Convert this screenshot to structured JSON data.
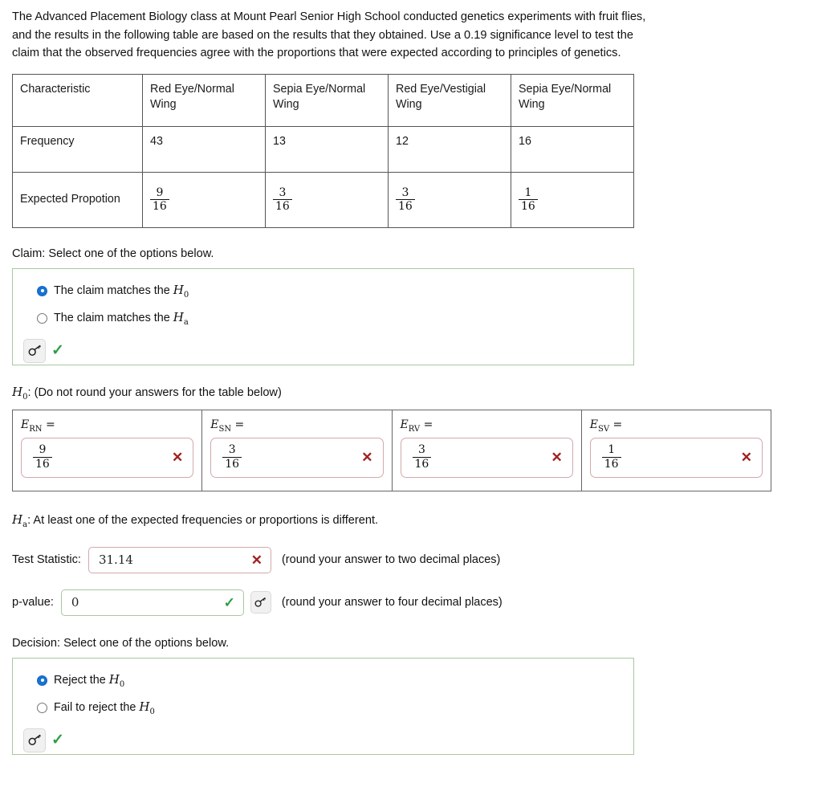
{
  "intro": "The Advanced Placement Biology class at Mount Pearl Senior High School conducted genetics experiments with fruit flies, and the results in the following table are based on the results that they obtained. Use a 0.19 significance level to test the claim that the observed frequencies agree with the proportions that were expected according to principles of genetics.",
  "table": {
    "headers": [
      "Characteristic",
      "Red Eye/Normal Wing",
      "Sepia Eye/Normal Wing",
      "Red Eye/Vestigial Wing",
      "Sepia Eye/Normal Wing"
    ],
    "frequency_label": "Frequency",
    "frequencies": [
      "43",
      "13",
      "12",
      "16"
    ],
    "expected_label": "Expected Propotion",
    "expected": [
      {
        "num": "9",
        "den": "16"
      },
      {
        "num": "3",
        "den": "16"
      },
      {
        "num": "3",
        "den": "16"
      },
      {
        "num": "1",
        "den": "16"
      }
    ]
  },
  "claim": {
    "prompt": "Claim: Select one of the options below.",
    "options": [
      {
        "label_pre": "The claim matches the ",
        "var": "H",
        "sub": "0",
        "selected": true
      },
      {
        "label_pre": "The claim matches the ",
        "var": "H",
        "sub": "a",
        "selected": false
      }
    ],
    "key_icon": "key-icon",
    "status_icon": "check-icon"
  },
  "h0": {
    "var": "H",
    "sub": "0",
    "note": ":  (Do not round your answers for the table below)",
    "cells": [
      {
        "label_var": "E",
        "label_sub": "RN",
        "eq": " =",
        "num": "9",
        "den": "16",
        "status_icon": "x-icon"
      },
      {
        "label_var": "E",
        "label_sub": "SN",
        "eq": " =",
        "num": "3",
        "den": "16",
        "status_icon": "x-icon"
      },
      {
        "label_var": "E",
        "label_sub": "RV",
        "eq": " =",
        "num": "3",
        "den": "16",
        "status_icon": "x-icon"
      },
      {
        "label_var": "E",
        "label_sub": "SV",
        "eq": " =",
        "num": "1",
        "den": "16",
        "status_icon": "x-icon"
      }
    ]
  },
  "ha": {
    "var": "H",
    "sub": "a",
    "text": ":  At least one of the expected frequencies or proportions is different."
  },
  "test_statistic": {
    "label": "Test Statistic:",
    "value": "31.14",
    "status_icon": "x-icon",
    "hint": "(round your answer to two decimal places)"
  },
  "p_value": {
    "label": "p-value:",
    "value": "0",
    "status_icon": "check-icon",
    "key_icon": "key-icon",
    "hint": "(round your answer to four decimal places)"
  },
  "decision": {
    "prompt": "Decision: Select one of the options below.",
    "options": [
      {
        "label_pre": "Reject the ",
        "var": "H",
        "sub": "0",
        "selected": true
      },
      {
        "label_pre": "Fail to reject the ",
        "var": "H",
        "sub": "0",
        "selected": false
      }
    ],
    "key_icon": "key-icon",
    "status_icon": "check-icon"
  },
  "colors": {
    "panel_border_ok": "#a8c8a0",
    "field_border_error": "#d3a9a9",
    "x_mark": "#a02020",
    "check": "#2f9e44",
    "radio_selected": "#1673d1"
  }
}
